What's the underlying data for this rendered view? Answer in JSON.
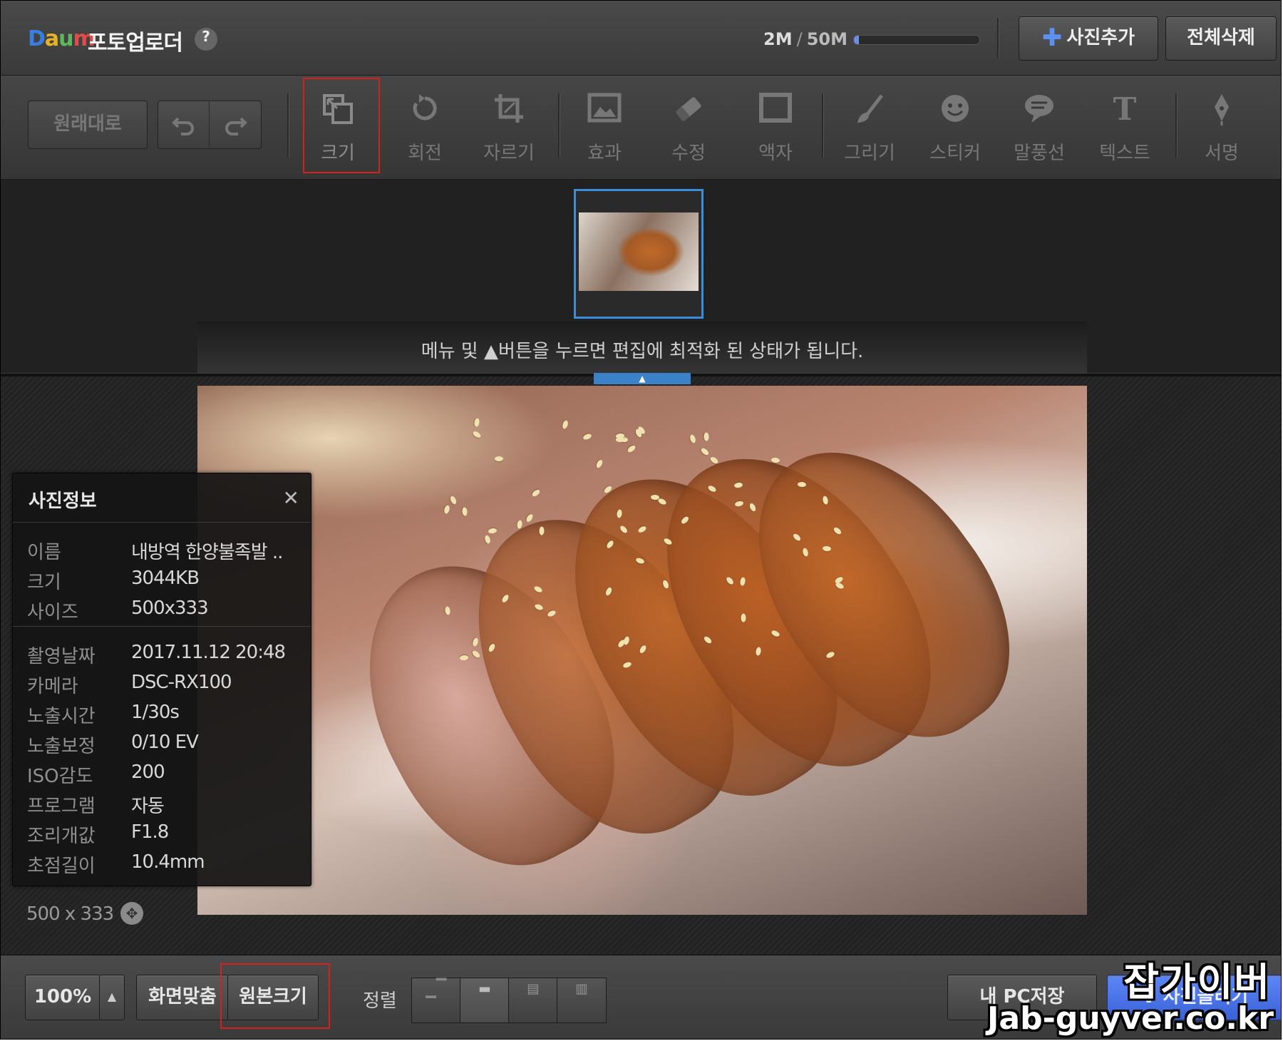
{
  "header": {
    "logo": "Daum",
    "title": "포토업로더",
    "help": "?",
    "storage_used": "2M",
    "storage_sep": "/",
    "storage_total": "50M",
    "storage_fraction": 0.04,
    "add_photo_label": "사진추가",
    "delete_all_label": "전체삭제"
  },
  "toolbar": {
    "reset_label": "원래대로",
    "tools": [
      {
        "label": "크기",
        "icon": "resize-icon"
      },
      {
        "label": "회전",
        "icon": "rotate-icon"
      },
      {
        "label": "자르기",
        "icon": "crop-icon"
      },
      {
        "label": "효과",
        "icon": "effect-icon"
      },
      {
        "label": "수정",
        "icon": "eraser-icon"
      },
      {
        "label": "액자",
        "icon": "frame-icon"
      },
      {
        "label": "그리기",
        "icon": "brush-icon"
      },
      {
        "label": "스티커",
        "icon": "sticker-icon"
      },
      {
        "label": "말풍선",
        "icon": "speech-bubble-icon"
      },
      {
        "label": "텍스트",
        "icon": "text-icon"
      },
      {
        "label": "서명",
        "icon": "pen-nib-icon"
      }
    ]
  },
  "strip": {
    "hint": "메뉴 및 ▲버튼을 누르면 편집에 최적화 된 상태가 됩니다."
  },
  "info_panel": {
    "title": "사진정보",
    "rows_top": [
      {
        "k": "이름",
        "v": "내방역 한양불족발 .."
      },
      {
        "k": "크기",
        "v": "3044KB"
      },
      {
        "k": "사이즈",
        "v": "500x333"
      }
    ],
    "rows_bottom": [
      {
        "k": "촬영날짜",
        "v": "2017.11.12 20:48"
      },
      {
        "k": "카메라",
        "v": "DSC-RX100"
      },
      {
        "k": "노출시간",
        "v": "1/30s"
      },
      {
        "k": "노출보정",
        "v": "0/10 EV"
      },
      {
        "k": "ISO감도",
        "v": "200"
      },
      {
        "k": "프로그램",
        "v": "자동"
      },
      {
        "k": "조리개값",
        "v": "F1.8"
      },
      {
        "k": "초점길이",
        "v": "10.4mm"
      }
    ]
  },
  "canvas": {
    "image_dims": "500 x 333"
  },
  "bottom": {
    "zoom": "100%",
    "zoom_stepper": "▲",
    "fit_label": "화면맞춤",
    "original_label": "원본크기",
    "align_label": "정렬",
    "save_pc_label": "내 PC저장",
    "upload_label": "사진올리기"
  },
  "watermark": {
    "line1": "잡가이버",
    "line2": "Jab-guyver.co.kr"
  }
}
